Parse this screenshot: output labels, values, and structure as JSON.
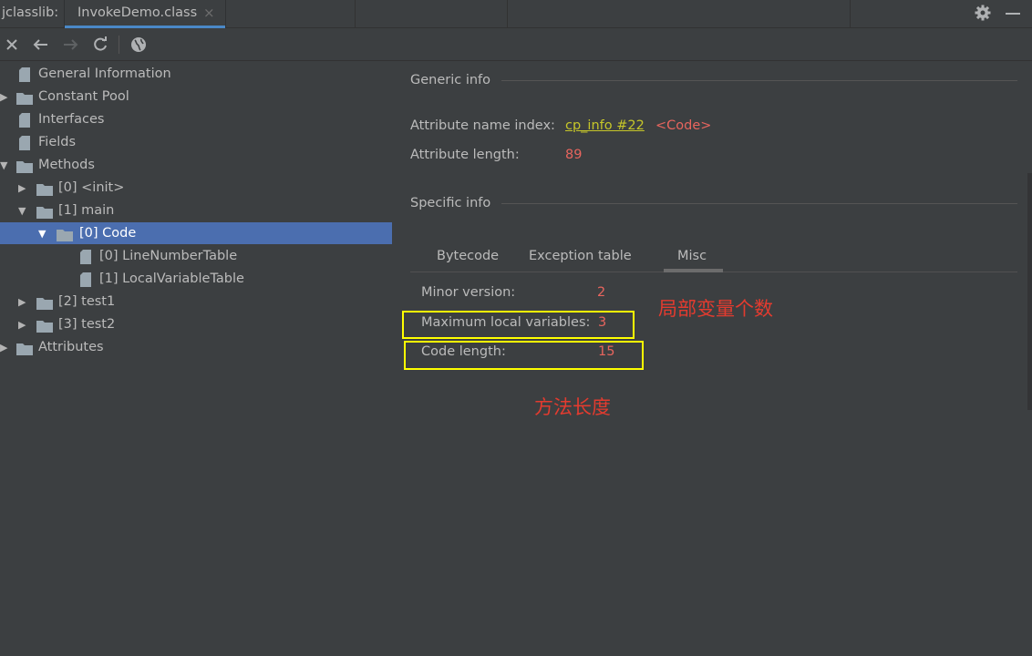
{
  "tabbar": {
    "prefix": "jclasslib:",
    "file_tab": "InvokeDemo.class",
    "close_glyph": "×",
    "icons": [
      "gear-icon",
      "minimize-icon"
    ],
    "accent": "#4a88c7"
  },
  "toolbar": {
    "icons": [
      "close-icon",
      "back-arrow-icon",
      "forward-arrow-icon",
      "refresh-icon",
      "globe-icon"
    ]
  },
  "tree": {
    "general": "General Information",
    "constant_pool": "Constant Pool",
    "interfaces": "Interfaces",
    "fields": "Fields",
    "methods": "Methods",
    "m0": "[0] <init>",
    "m1": "[1] main",
    "m1_code": "[0] Code",
    "line_table": "[0] LineNumberTable",
    "local_table": "[1] LocalVariableTable",
    "m2": "[2] test1",
    "m3": "[3] test2",
    "attributes": "Attributes",
    "selected_color": "#4b6eaf"
  },
  "panel": {
    "generic_title": "Generic info",
    "attr_name_label": "Attribute name index:",
    "attr_name_link": "cp_info #22",
    "attr_name_value": "<Code>",
    "attr_len_label": "Attribute length:",
    "attr_len_value": "89",
    "specific_title": "Specific info",
    "tabs": [
      "Bytecode",
      "Exception table",
      "Misc"
    ],
    "active_tab": "Misc",
    "minor_label": "Minor version:",
    "minor_value": "2",
    "max_locals_label": "Maximum local variables:",
    "max_locals_value": "3",
    "code_len_label": "Code length:",
    "code_len_value": "15",
    "value_color": "#e8655e",
    "link_color": "#c6c629"
  },
  "annotations": {
    "locals_note": "局部变量个数",
    "code_note": "方法长度",
    "box_color": "#ffff00",
    "text_color": "#e33b2f"
  }
}
